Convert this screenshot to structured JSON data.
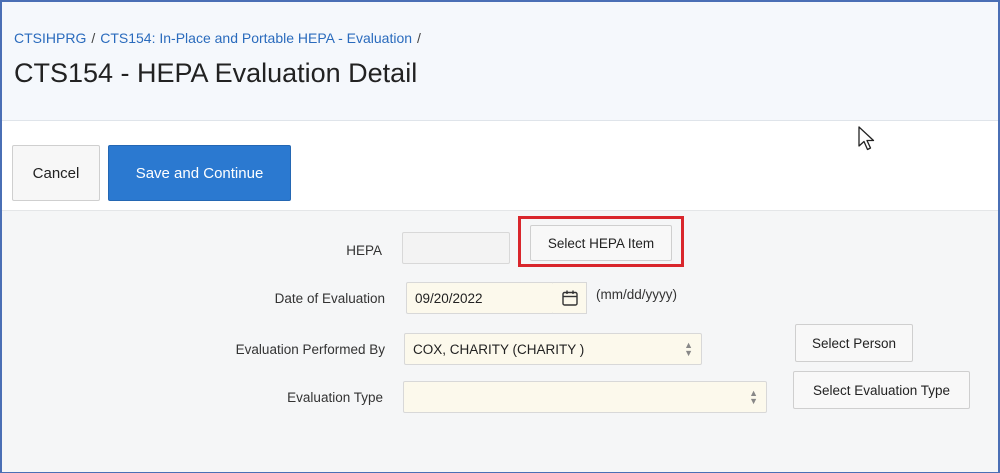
{
  "header": {
    "breadcrumb": [
      {
        "label": "CTSIHPRG"
      },
      {
        "label": "CTS154: In-Place and Portable HEPA - Evaluation"
      }
    ],
    "separator": "/",
    "title": "CTS154 - HEPA Evaluation Detail"
  },
  "toolbar": {
    "cancel_label": "Cancel",
    "save_label": "Save and Continue"
  },
  "form": {
    "hepa": {
      "label": "HEPA",
      "value": "",
      "button_label": "Select HEPA Item"
    },
    "date_of_evaluation": {
      "label": "Date of Evaluation",
      "value": "09/20/2022",
      "format_hint": "(mm/dd/yyyy)"
    },
    "performed_by": {
      "label": "Evaluation Performed By",
      "value": "COX, CHARITY (CHARITY )",
      "button_label": "Select Person"
    },
    "evaluation_type": {
      "label": "Evaluation Type",
      "value": "",
      "button_label": "Select Evaluation Type"
    }
  },
  "icons": {
    "calendar": "calendar-icon",
    "select_arrow": "sort-arrows-icon",
    "cursor": "mouse-pointer-icon"
  },
  "colors": {
    "primary_button": "#2b79d0",
    "breadcrumb_link": "#2a6bbd",
    "highlight_box": "#d9262c",
    "input_background": "#fcf9ec"
  }
}
